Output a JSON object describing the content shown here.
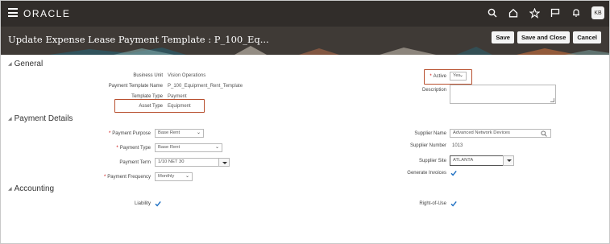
{
  "brand": "ORACLE",
  "header_icons": [
    "search-icon",
    "home-icon",
    "favorite-star-icon",
    "flag-icon",
    "notifications-bell-icon"
  ],
  "user_initials": "KB",
  "page": {
    "title": "Update Expense Lease Payment Template : P_100_Eq...",
    "buttons": {
      "save": "Save",
      "save_close": "Save and Close",
      "cancel": "Cancel"
    }
  },
  "general": {
    "title": "General",
    "business_unit": {
      "label": "Business Unit",
      "value": "Vision Operations"
    },
    "template_name": {
      "label": "Payment Template Name",
      "value": "P_100_Equipment_Rent_Template"
    },
    "template_type": {
      "label": "Template Type",
      "value": "Payment"
    },
    "asset_type": {
      "label": "Asset Type",
      "value": "Equipment"
    },
    "active": {
      "label": "Active",
      "value": "Yes"
    },
    "description": {
      "label": "Description",
      "value": ""
    }
  },
  "payment": {
    "title": "Payment Details",
    "purpose": {
      "label": "Payment Purpose",
      "value": "Base Rent"
    },
    "type": {
      "label": "Payment Type",
      "value": "Base Rent"
    },
    "term": {
      "label": "Payment Term",
      "value": "1/10 NET 30"
    },
    "frequency": {
      "label": "Payment Frequency",
      "value": "Monthly"
    },
    "supplier_name": {
      "label": "Supplier Name",
      "value": "Advanced Network Devices"
    },
    "supplier_number": {
      "label": "Supplier Number",
      "value": "1013"
    },
    "supplier_site": {
      "label": "Supplier Site",
      "value": "ATLANTA"
    },
    "generate_invoices": {
      "label": "Generate Invoices",
      "checked": true
    }
  },
  "accounting": {
    "title": "Accounting",
    "liability": {
      "label": "Liability",
      "checked": true
    },
    "right_of_use": {
      "label": "Right-of-Use",
      "checked": true
    }
  },
  "colors": {
    "topbar": "#312d2a",
    "titleband": "#3f3a36",
    "highlight": "#b8502f",
    "check": "#1b6ec2"
  }
}
